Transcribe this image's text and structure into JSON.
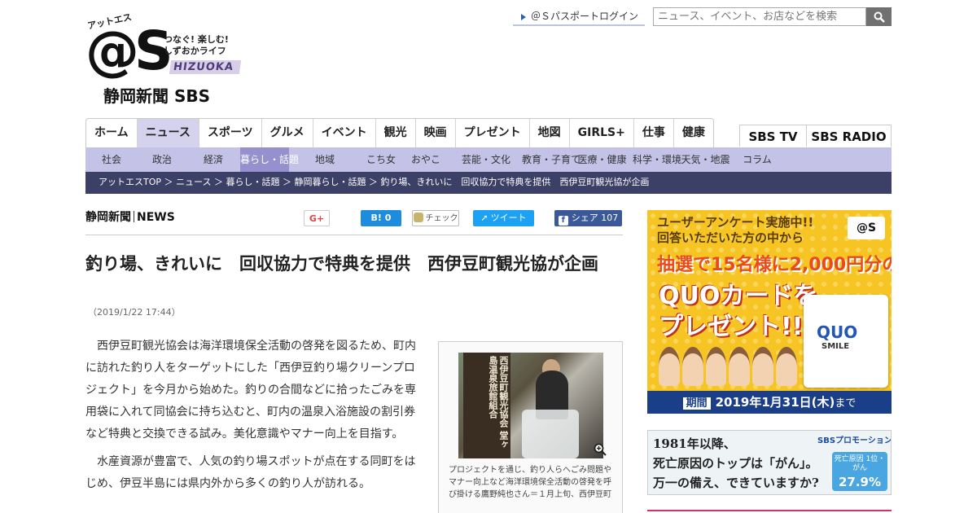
{
  "site": {
    "logo_kana": "アットエス",
    "logo_mark": "@S",
    "tagline1": "つなぐ! 楽しむ!",
    "tagline2": "しずおかライフ",
    "logo_region": "HIZUOKA",
    "logo_paper": "静岡新聞 SBS"
  },
  "header": {
    "login_label": "＠Ｓパスポートログイン",
    "search_placeholder": "ニュース、イベント、お店などを検索"
  },
  "nav": {
    "items": [
      "ホーム",
      "ニュース",
      "スポーツ",
      "グルメ",
      "イベント",
      "観光",
      "映画",
      "プレゼント",
      "地図",
      "GIRLS+",
      "仕事",
      "健康"
    ],
    "active_index": 1,
    "sbs_tv": "SBS TV",
    "sbs_radio": "SBS RADIO"
  },
  "subnav": {
    "items": [
      "社会",
      "政治",
      "経済",
      "暮らし・話題",
      "地域",
      "こち女",
      "おやこ",
      "芸能・文化",
      "教育・子育て",
      "医療・健康",
      "科学・環境",
      "天気・地震",
      "コラム"
    ],
    "active_index": 3
  },
  "breadcrumb": "アットエスTOP ＞ ニュース ＞ 暮らし・話題 ＞ 静岡暮らし・話題 ＞ 釣り場、きれいに　回収協力で特典を提供　西伊豆町観光協が企画",
  "article": {
    "source_logo": "静岡新聞",
    "source_suffix": "NEWS",
    "share": {
      "google": "G+",
      "hatena": "B! 0",
      "check": "チェック",
      "tweet": "ツイート",
      "facebook": "シェア 107"
    },
    "title": "釣り場、きれいに　回収協力で特典を提供　西伊豆町観光協が企画",
    "date": "（2019/1/22 17:44）",
    "paragraphs": [
      "西伊豆町観光協会は海洋環境保全活動の啓発を図るため、町内に訪れた釣り人をターゲットにした「西伊豆釣り場クリーンプロジェクト」を今月から始めた。釣りの合間などに拾ったごみを専用袋に入れて同協会に持ち込むと、町内の温泉入浴施設の割引券など特典と交換できる試み。美化意識やマナー向上を目指す。",
      "水産資源が豊富で、人気の釣り場スポットが点在する同町をはじめ、伊豆半島には県内外から多くの釣り人が訪れる。"
    ],
    "photo_sign": "西伊豆町観光協会 堂ヶ島温泉旅館組合",
    "photo_caption": "プロジェクトを通じ、釣り人らへごみ問題やマナー向上など海洋環境保全活動の啓発を呼び掛ける鷹野純也さん＝１月上旬、西伊豆町"
  },
  "ads": {
    "survey": {
      "headline1": "ユーザーアンケート実施中!!",
      "headline2": "回答いただいた方の中から",
      "mini_logo": "@S",
      "prize": "抽選で15名様に2,000円分の",
      "quo_line1": "QUOカードを",
      "quo_line2": "プレゼント!!",
      "card_brand": "QUO",
      "card_sub": "SMILE",
      "period_label": "期間",
      "period_date": "2019年1月31日(木)",
      "period_suffix": "まで"
    },
    "insurance": {
      "line1": "1981年以降、",
      "line2": "死亡原因のトップは「がん」。",
      "line3": "万一の備え、できていますか?",
      "brand": "SBSプロモーション",
      "stat_label": "死亡原因 1位・がん",
      "stat_value": "27.9%"
    }
  }
}
